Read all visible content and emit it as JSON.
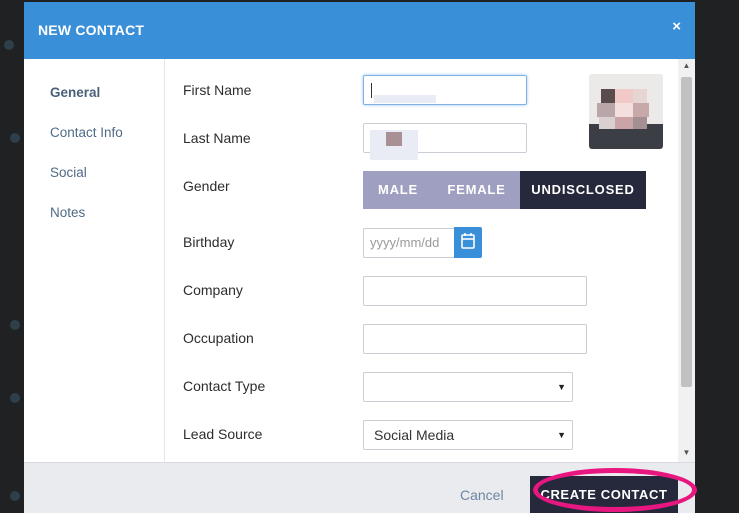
{
  "modal": {
    "title": "NEW CONTACT",
    "close_label": "×"
  },
  "nav": {
    "items": [
      {
        "label": "General",
        "active": true
      },
      {
        "label": "Contact Info",
        "active": false
      },
      {
        "label": "Social",
        "active": false
      },
      {
        "label": "Notes",
        "active": false
      }
    ]
  },
  "form": {
    "first_name": {
      "label": "First Name",
      "value": ""
    },
    "last_name": {
      "label": "Last Name",
      "value": ""
    },
    "gender": {
      "label": "Gender",
      "options": [
        "MALE",
        "FEMALE",
        "UNDISCLOSED"
      ],
      "selected": "UNDISCLOSED"
    },
    "birthday": {
      "label": "Birthday",
      "placeholder": "yyyy/mm/dd"
    },
    "company": {
      "label": "Company",
      "value": ""
    },
    "occupation": {
      "label": "Occupation",
      "value": ""
    },
    "contact_type": {
      "label": "Contact Type",
      "value": ""
    },
    "lead_source": {
      "label": "Lead Source",
      "value": "Social Media"
    }
  },
  "footer": {
    "cancel_label": "Cancel",
    "create_label": "CREATE CONTACT"
  },
  "colors": {
    "header": "#3a8fd9",
    "accent_dark": "#26283b",
    "toggle_inactive": "#9f9fc1",
    "highlight": "#e8177f"
  },
  "icons": [
    "close-icon",
    "calendar-icon",
    "dropdown-arrow-icon",
    "avatar-image"
  ]
}
